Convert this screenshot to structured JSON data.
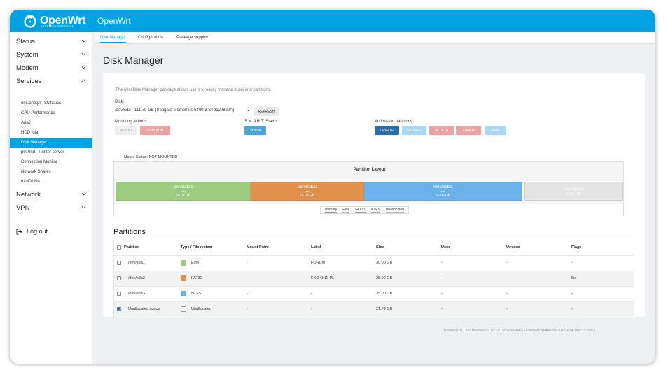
{
  "app": {
    "brand": "OpenWrt",
    "brand_sub": "WIRELESS FREEDOM",
    "hostname": "OpenWrt"
  },
  "sidebar": {
    "status": "Status",
    "system": "System",
    "modem": "Modem",
    "services": "Services",
    "services_items": [
      "eko.one.pl - Statistics",
      "CPU Performance",
      "Aria2",
      "HDD Idle",
      "Disk Manager",
      "p910nd - Printer server",
      "Connection Monitor",
      "Network Shares",
      "miniDLNA"
    ],
    "network": "Network",
    "vpn": "VPN",
    "logout": "Log out"
  },
  "tabs": [
    "Disk Manager",
    "Configuration",
    "Package support"
  ],
  "page_title": "Disk Manager",
  "description": "The Mini Disk Manager package allows users to easily manage disks and partitions.",
  "disk": {
    "label": "Disk:",
    "selected": "/dev/sda - 111.79 GB (Seagate Momentus 5400.3 ST9120822A)",
    "refresh": "REFRESH"
  },
  "mounting": {
    "label": "Mounting actions:",
    "mount": "MOUNT",
    "unmount": "UNMOUNT"
  },
  "smart": {
    "label": "S.M.A.R.T. Status:",
    "show": "SHOW"
  },
  "partition_actions": {
    "label": "Actions on partitions:",
    "create": "CREATE",
    "expand": "EXPAND",
    "delete": "DELETE",
    "format": "FORMAT",
    "wipe": "WIPE"
  },
  "mount_status": "Mount Status: NOT MOUNTED",
  "layout": {
    "title": "Partition Layout",
    "segments": [
      {
        "name": "/dev/sda1",
        "type": "ext4",
        "size": "30.00 GB",
        "color": "#9ccc7e"
      },
      {
        "name": "/dev/sda2",
        "type": "vfat",
        "size": "25.00 GB",
        "color": "#e1914a"
      },
      {
        "name": "/dev/sda3",
        "type": "ntfs",
        "size": "35.00 GB",
        "color": "#69b3ea"
      },
      {
        "name": "Free Space",
        "type": "",
        "size": "21.79 GB",
        "color": "#e3e3e3"
      }
    ],
    "legend": [
      "Primary",
      "Ext4",
      "FAT32",
      "NTFS",
      "Unallocated"
    ]
  },
  "partitions": {
    "title": "Partitions",
    "columns": [
      "Partition",
      "Type / Filesystem",
      "Mount Point",
      "Label",
      "Size",
      "Used",
      "Unused",
      "Flags"
    ],
    "rows": [
      {
        "partition": "/dev/sda1",
        "fs": "Ext4",
        "color": "#9ccc7e",
        "mount": "-",
        "label": "FORUM",
        "size": "30.00 GB",
        "used": "-",
        "unused": "-",
        "flags": "-",
        "checked": false
      },
      {
        "partition": "/dev/sda2",
        "fs": "FAT32",
        "color": "#e1914a",
        "mount": "-",
        "label": "EKO ONE PL",
        "size": "25.00 GB",
        "used": "-",
        "unused": "-",
        "flags": "lba",
        "checked": false
      },
      {
        "partition": "/dev/sda3",
        "fs": "NTFS",
        "color": "#69b3ea",
        "mount": "-",
        "label": "-",
        "size": "35.00 GB",
        "used": "-",
        "unused": "-",
        "flags": "-",
        "checked": false
      },
      {
        "partition": "Unallocated space",
        "fs": "Unallocated",
        "color": "#ffffff",
        "mount": "-",
        "label": "-",
        "size": "21.79 GB",
        "used": "-",
        "unused": "-",
        "flags": "-",
        "checked": true
      }
    ]
  },
  "footer": "Powered by LuCI Master (26.012.02195~2a84e49) / OpenWrt SNAPSHOT (r32674-16422510b5)"
}
